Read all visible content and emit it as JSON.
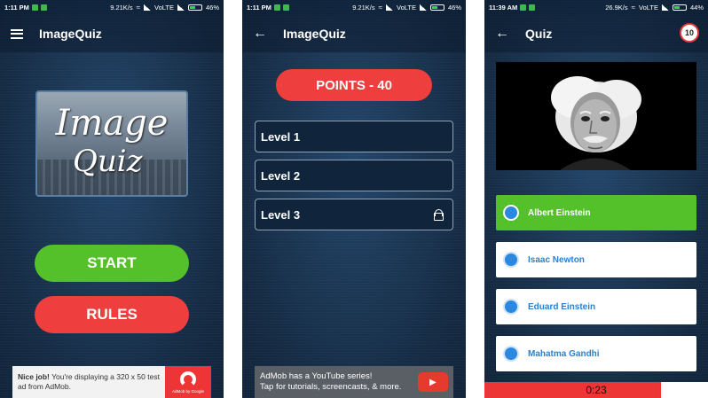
{
  "screens": [
    {
      "status": {
        "time": "1:11 PM",
        "speed": "9.21K/s",
        "network": "VoLTE",
        "battery": "46%"
      },
      "appbar": {
        "title": "ImageQuiz"
      },
      "logo": {
        "line1": "Image",
        "line2": "Quiz"
      },
      "buttons": {
        "start": "START",
        "rules": "RULES"
      },
      "ad": {
        "bold": "Nice job!",
        "text": " You're displaying a 320 x 50 test ad from AdMob.",
        "brand": "AdMob by Google"
      }
    },
    {
      "status": {
        "time": "1:11 PM",
        "speed": "9.21K/s",
        "network": "VoLTE",
        "battery": "46%"
      },
      "appbar": {
        "title": "ImageQuiz"
      },
      "points": "POINTS - 40",
      "levels": [
        {
          "label": "Level 1",
          "locked": false
        },
        {
          "label": "Level 2",
          "locked": false
        },
        {
          "label": "Level 3",
          "locked": true
        }
      ],
      "ad": {
        "line1": "AdMob has a YouTube series!",
        "line2": "Tap for tutorials, screencasts, & more."
      }
    },
    {
      "status": {
        "time": "11:39 AM",
        "speed": "26.9K/s",
        "network": "VoLTE",
        "battery": "44%"
      },
      "appbar": {
        "title": "Quiz"
      },
      "question_number": "10",
      "options": [
        {
          "label": "Albert Einstein",
          "state": "correct"
        },
        {
          "label": "Isaac Newton",
          "state": "normal"
        },
        {
          "label": "Eduard Einstein",
          "state": "normal"
        },
        {
          "label": "Mahatma Gandhi",
          "state": "normal"
        }
      ],
      "timer": {
        "text": "0:23",
        "fraction_remaining": 0.79
      }
    }
  ],
  "colors": {
    "green": "#55c12a",
    "red": "#ee3e3e",
    "navy": "#1a3350",
    "option_text": "#2b7fd0"
  }
}
